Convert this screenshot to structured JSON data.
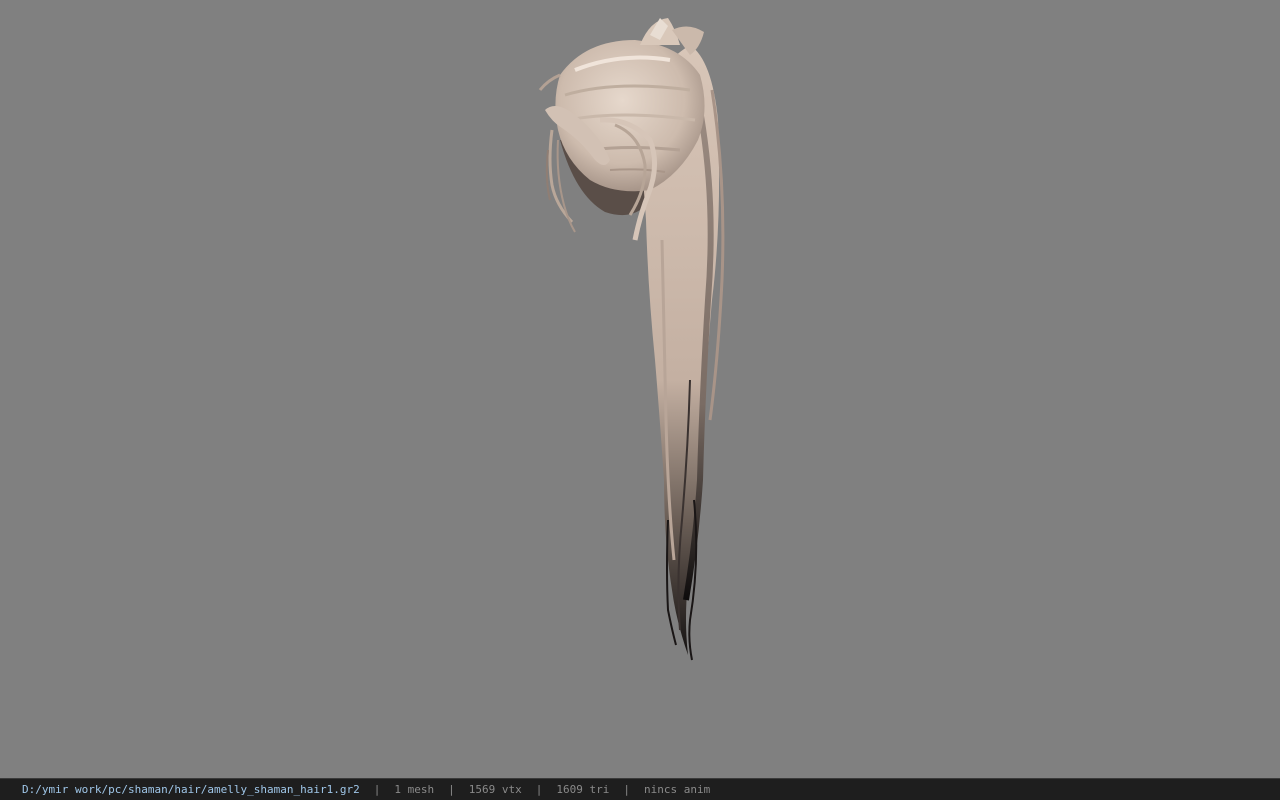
{
  "viewer": {
    "background_color": "#808080",
    "model_name": "amelly_shaman_hair1"
  },
  "status_bar": {
    "file_path": "D:/ymir work/pc/shaman/hair/amelly_shaman_hair1.gr2",
    "separator": "|",
    "mesh_count": "1 mesh",
    "vertex_count": "1569 vtx",
    "triangle_count": "1609 tri",
    "anim_status": "nincs anim",
    "path_color": "#9fc6e8",
    "text_color": "#8a8a8a",
    "bg_color": "#1e1e1e"
  }
}
